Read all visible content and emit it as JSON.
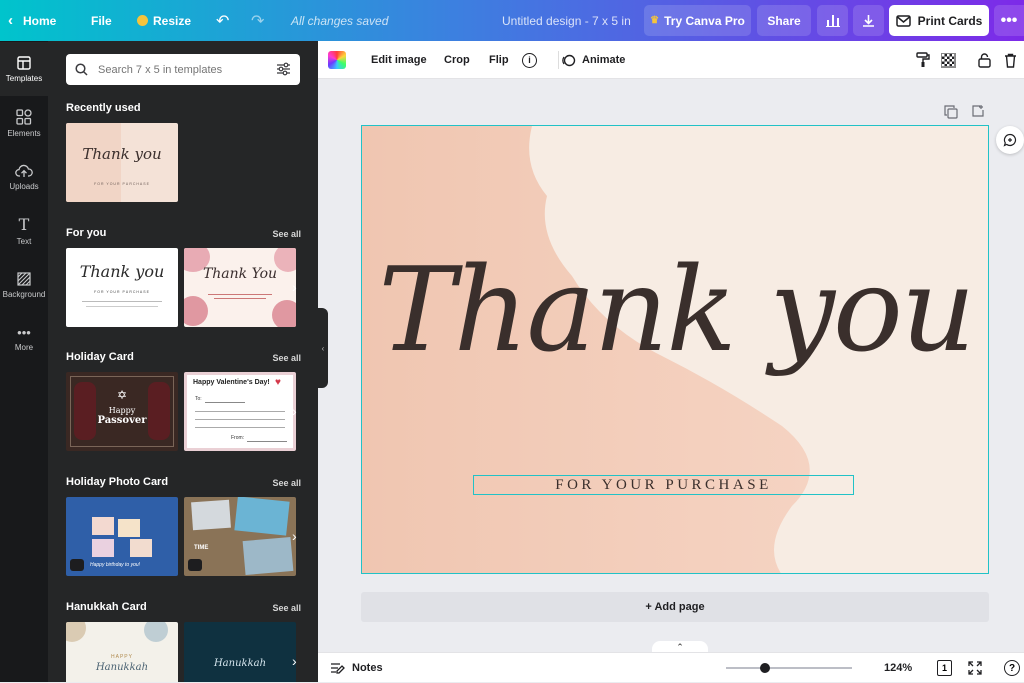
{
  "topbar": {
    "home_label": "Home",
    "file_label": "File",
    "resize_label": "Resize",
    "saved_status": "All changes saved",
    "design_title": "Untitled design - 7 x 5 in",
    "try_pro_label": "Try Canva Pro",
    "share_label": "Share",
    "print_label": "Print Cards"
  },
  "rail": {
    "items": [
      {
        "label": "Templates",
        "icon": "layout-icon"
      },
      {
        "label": "Elements",
        "icon": "shapes-icon"
      },
      {
        "label": "Uploads",
        "icon": "cloud-upload-icon"
      },
      {
        "label": "Text",
        "icon": "text-icon"
      },
      {
        "label": "Background",
        "icon": "hatch-icon"
      },
      {
        "label": "More",
        "icon": "more-dots-icon"
      }
    ]
  },
  "panel": {
    "search_placeholder": "Search 7 x 5 in templates",
    "sections": [
      {
        "title": "Recently used",
        "see_all": ""
      },
      {
        "title": "For you",
        "see_all": "See all"
      },
      {
        "title": "Holiday Card",
        "see_all": "See all"
      },
      {
        "title": "Holiday Photo Card",
        "see_all": "See all"
      },
      {
        "title": "Hanukkah Card",
        "see_all": "See all"
      }
    ],
    "thumbs": {
      "recent_title": "Thank you",
      "recent_sub": "FOR YOUR PURCHASE",
      "fy1_title": "Thank you",
      "fy1_sub": "FOR YOUR PURCHASE",
      "fy2_title": "Thank You",
      "hol1_title": "Happy Passover",
      "hol1_line1": "Happy",
      "hol1_line2": "Passover",
      "hol2_title": "Happy Valentine's Day!",
      "hol2_to": "To:",
      "hol2_from": "From:",
      "photo1_text": "Happy birthday to you!",
      "photo2_text": "TIME",
      "han1_line1": "HAPPY",
      "han1_line2": "Hanukkah",
      "han2_line1": "Hanukkah"
    }
  },
  "ctxbar": {
    "edit_image": "Edit image",
    "crop": "Crop",
    "flip": "Flip",
    "animate": "Animate"
  },
  "canvas": {
    "title": "Thank you",
    "subtitle": "FOR YOUR PURCHASE",
    "add_page": "+ Add page"
  },
  "bottombar": {
    "notes": "Notes",
    "zoom": "124%",
    "page_count": "1",
    "zoom_fraction": 0.31
  },
  "colors": {
    "accent_teal": "#21c2c7",
    "gradient_start": "#00c4cc",
    "gradient_end": "#7d2ae8",
    "card_peach": "#f4cdb9",
    "card_cream": "#f7ece3"
  }
}
